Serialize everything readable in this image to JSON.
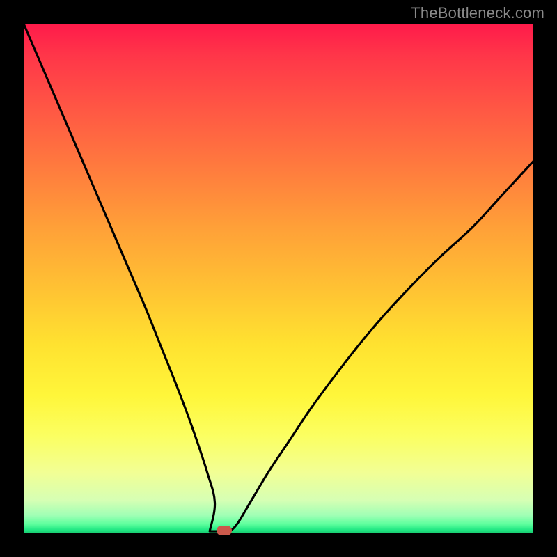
{
  "watermark": "TheBottleneck.com",
  "colors": {
    "frame": "#000000",
    "curve": "#000000",
    "marker": "#cb594b"
  },
  "chart_data": {
    "type": "line",
    "title": "",
    "xlabel": "",
    "ylabel": "",
    "xlim": [
      0,
      100
    ],
    "ylim": [
      0,
      100
    ],
    "note": "Bottleneck-style V curve. Values are visual estimates read from the plot (percent of plot area). Minimum near x≈39 at y≈0; left branch reaches y≈100 at x≈0; right branch reaches y≈73 at x≈100.",
    "series": [
      {
        "name": "bottleneck-curve",
        "x": [
          0,
          3,
          6,
          9,
          12,
          15,
          18,
          21,
          24,
          27,
          30,
          33,
          36,
          37.5,
          39,
          40.5,
          42,
          45,
          48,
          52,
          56,
          60,
          65,
          70,
          76,
          82,
          88,
          94,
          100
        ],
        "y": [
          100,
          93,
          86,
          79,
          72,
          65,
          58,
          51,
          44,
          36.5,
          29,
          21,
          12,
          6,
          0.4,
          0.4,
          2,
          7,
          12,
          18,
          24,
          29.5,
          36,
          42,
          48.5,
          54.5,
          60,
          66.5,
          73
        ]
      }
    ],
    "marker": {
      "x": 39.3,
      "y": 0.6
    },
    "flat_bottom": {
      "x0": 36.5,
      "x1": 40.5,
      "y": 0.4
    }
  }
}
